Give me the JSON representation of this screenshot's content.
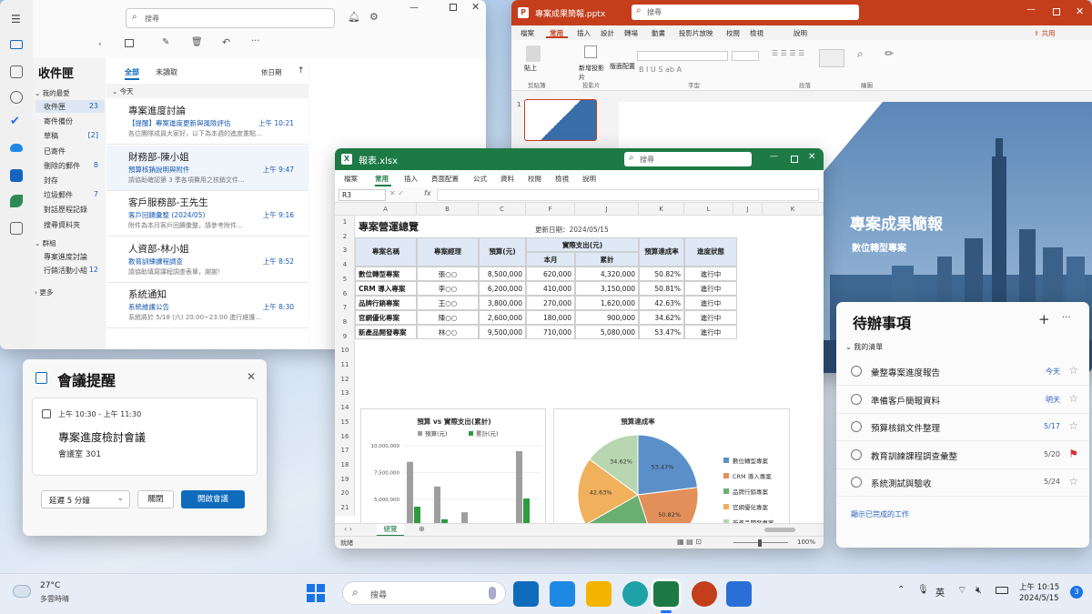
{
  "outlook": {
    "search_placeholder": "搜尋",
    "folder_title": "收件匣",
    "favorites_label": "我的最愛",
    "folders": [
      {
        "name": "收件匣",
        "count": "23"
      },
      {
        "name": "寄件備份",
        "count": ""
      },
      {
        "name": "草稿",
        "count": "[2]"
      },
      {
        "name": "已寄件",
        "count": ""
      },
      {
        "name": "刪除的郵件",
        "count": "8"
      },
      {
        "name": "封存",
        "count": ""
      },
      {
        "name": "垃圾郵件",
        "count": "7"
      },
      {
        "name": "對話歷程記錄",
        "count": ""
      },
      {
        "name": "搜尋資料夾",
        "count": ""
      }
    ],
    "groups_label": "群組",
    "groups": [
      {
        "name": "專案進度討論",
        "count": ""
      },
      {
        "name": "行銷活動小組",
        "count": "12"
      }
    ],
    "add_more": "更多",
    "tabs": [
      "全部",
      "未讀取"
    ],
    "sort_label": "依日期",
    "sort_arrow": "↑",
    "today_label": "今天",
    "messages": [
      {
        "sender": "專案進度討論",
        "subject": "【提醒】專案進度更新與風險評估",
        "time": "上午 10:21",
        "preview": "各位團隊成員大家好，以下為本週的進度重點..."
      },
      {
        "sender": "財務部-陳小姐",
        "subject": "預算核銷說明與附件",
        "time": "上午 9:47",
        "preview": "請協助確認第 3 季各項費用之核銷文件..."
      },
      {
        "sender": "客戶服務部-王先生",
        "subject": "客戶回饋彙整 (2024/05)",
        "time": "上午 9:16",
        "preview": "附件為本月客戶回饋彙整，請參考附件..."
      },
      {
        "sender": "人資部-林小姐",
        "subject": "教育訓練課程調查",
        "time": "上午 8:52",
        "preview": "請協助填寫課程調查表單，謝謝！"
      },
      {
        "sender": "系統通知",
        "subject": "系統維護公告",
        "time": "上午 8:30",
        "preview": "系統將於 5/18 (六) 20:00~23:00 進行維護..."
      }
    ]
  },
  "powerpoint": {
    "filename": "專案成果簡報.pptx",
    "search_placeholder": "搜尋",
    "share_label": "共用",
    "tabs": [
      "檔案",
      "常用",
      "插入",
      "設計",
      "轉場",
      "動畫",
      "投影片放映",
      "校閱",
      "檢視",
      "說明"
    ],
    "active_tab": "常用",
    "groups": [
      "剪貼簿",
      "投影片",
      "字型",
      "段落",
      "繪圖"
    ],
    "buttons": [
      "貼上",
      "新增投影片",
      "版面配置",
      "圖案",
      "排列",
      "快速樣式",
      "選取",
      "編輯"
    ],
    "slide_number": "1",
    "slide_title": "專案成果簡報",
    "slide_subtitle": "數位轉型專案"
  },
  "excel": {
    "filename": "報表.xlsx",
    "search_placeholder": "搜尋",
    "tabs": [
      "檔案",
      "常用",
      "插入",
      "頁面配置",
      "公式",
      "資料",
      "校閱",
      "檢視",
      "說明"
    ],
    "active_tab": "常用",
    "name_box": "R3",
    "fx": "fx",
    "columns": [
      "A",
      "B",
      "C",
      "F",
      "J",
      "K",
      "L",
      "J",
      "K"
    ],
    "rows": [
      "1",
      "2",
      "3",
      "4",
      "5",
      "6",
      "7",
      "8",
      "9",
      "10",
      "11",
      "12",
      "13",
      "14",
      "15",
      "16",
      "17",
      "18",
      "19",
      "20",
      "21"
    ],
    "sheet_title": "專案營運總覽",
    "update_date": "更新日期：2024/05/15",
    "headers": {
      "name": "專案名稱",
      "manager": "專案經理",
      "budget": "預算(元)",
      "actual": "實際支出(元)",
      "month": "本月",
      "total": "累計",
      "rate": "預算達成率",
      "status": "進度狀態"
    },
    "table": [
      {
        "name": "數位轉型專案",
        "manager": "張○○",
        "budget": "8,500,000",
        "month": "620,000",
        "total": "4,320,000",
        "rate": "50.82%",
        "status": "進行中"
      },
      {
        "name": "CRM 導入專案",
        "manager": "李○○",
        "budget": "6,200,000",
        "month": "410,000",
        "total": "3,150,000",
        "rate": "50.81%",
        "status": "進行中"
      },
      {
        "name": "品牌行銷專案",
        "manager": "王○○",
        "budget": "3,800,000",
        "month": "270,000",
        "total": "1,620,000",
        "rate": "42.63%",
        "status": "進行中"
      },
      {
        "name": "官網優化專案",
        "manager": "陳○○",
        "budget": "2,600,000",
        "month": "180,000",
        "total": "900,000",
        "rate": "34.62%",
        "status": "進行中"
      },
      {
        "name": "新產品開發專案",
        "manager": "林○○",
        "budget": "9,500,000",
        "month": "710,000",
        "total": "5,080,000",
        "rate": "53.47%",
        "status": "進行中"
      }
    ],
    "sheet_tab": "總覽",
    "status_left": "就緒",
    "zoom": "100%"
  },
  "chart_data": [
    {
      "type": "bar",
      "title": "預算 vs 實際支出(累計)",
      "categories": [
        "數位轉型專案",
        "CRM 導入專案",
        "品牌行銷專案",
        "官網優化專案",
        "新產品開發專案"
      ],
      "series": [
        {
          "name": "預算(元)",
          "values": [
            8500000,
            6200000,
            3800000,
            2600000,
            9500000
          ],
          "color": "#9e9e9e"
        },
        {
          "name": "累計(元)",
          "values": [
            4320000,
            3150000,
            1620000,
            900000,
            5080000
          ],
          "color": "#2e9b3e"
        }
      ],
      "ylim": [
        0,
        10000000
      ],
      "y_ticks": [
        "0",
        "2,500,000",
        "5,000,000",
        "7,500,000",
        "10,000,000"
      ],
      "legend": "top"
    },
    {
      "type": "pie",
      "title": "預算達成率",
      "labels": [
        "數位轉型專案",
        "CRM 導入專案",
        "品牌行銷專案",
        "官網優化專案",
        "新產品開發專案"
      ],
      "values": [
        53.47,
        50.82,
        50.81,
        42.63,
        34.62
      ],
      "value_labels": [
        "53.47%",
        "50.82%",
        "50.81%",
        "42.63%",
        "34.62%"
      ],
      "colors": [
        "#5b8fc8",
        "#e38f5a",
        "#6aae72",
        "#f0b05c",
        "#b8d6b0"
      ],
      "legend": "right"
    }
  ],
  "reminder": {
    "title": "會議提醒",
    "time": "上午 10:30 - 上午 11:30",
    "meeting": "專案進度檢討會議",
    "room": "會議室 301",
    "snooze": "延遲 5 分鐘",
    "dismiss": "關閉",
    "open": "開啟會議"
  },
  "todo": {
    "title": "待辦事項",
    "list_name": "我的清單",
    "tasks": [
      {
        "title": "彙整專案進度報告",
        "due": "今天",
        "flag": false
      },
      {
        "title": "準備客戶簡報資料",
        "due": "明天",
        "flag": false
      },
      {
        "title": "預算核銷文件整理",
        "due": "5/17",
        "flag": false
      },
      {
        "title": "教育訓練課程調查彙整",
        "due": "5/20",
        "flag": true
      },
      {
        "title": "系統測試與驗收",
        "due": "5/24",
        "flag": false
      }
    ],
    "show_completed": "顯示已完成的工作"
  },
  "taskbar": {
    "temperature": "27°C",
    "weather": "多雲時晴",
    "search_placeholder": "搜尋",
    "ime": "英",
    "time": "上午 10:15",
    "date": "2024/5/15",
    "notification_count": "3"
  },
  "colors": {
    "outlook": "#0f6cbd",
    "excel": "#1d7a45",
    "powerpoint": "#c43e1c"
  }
}
